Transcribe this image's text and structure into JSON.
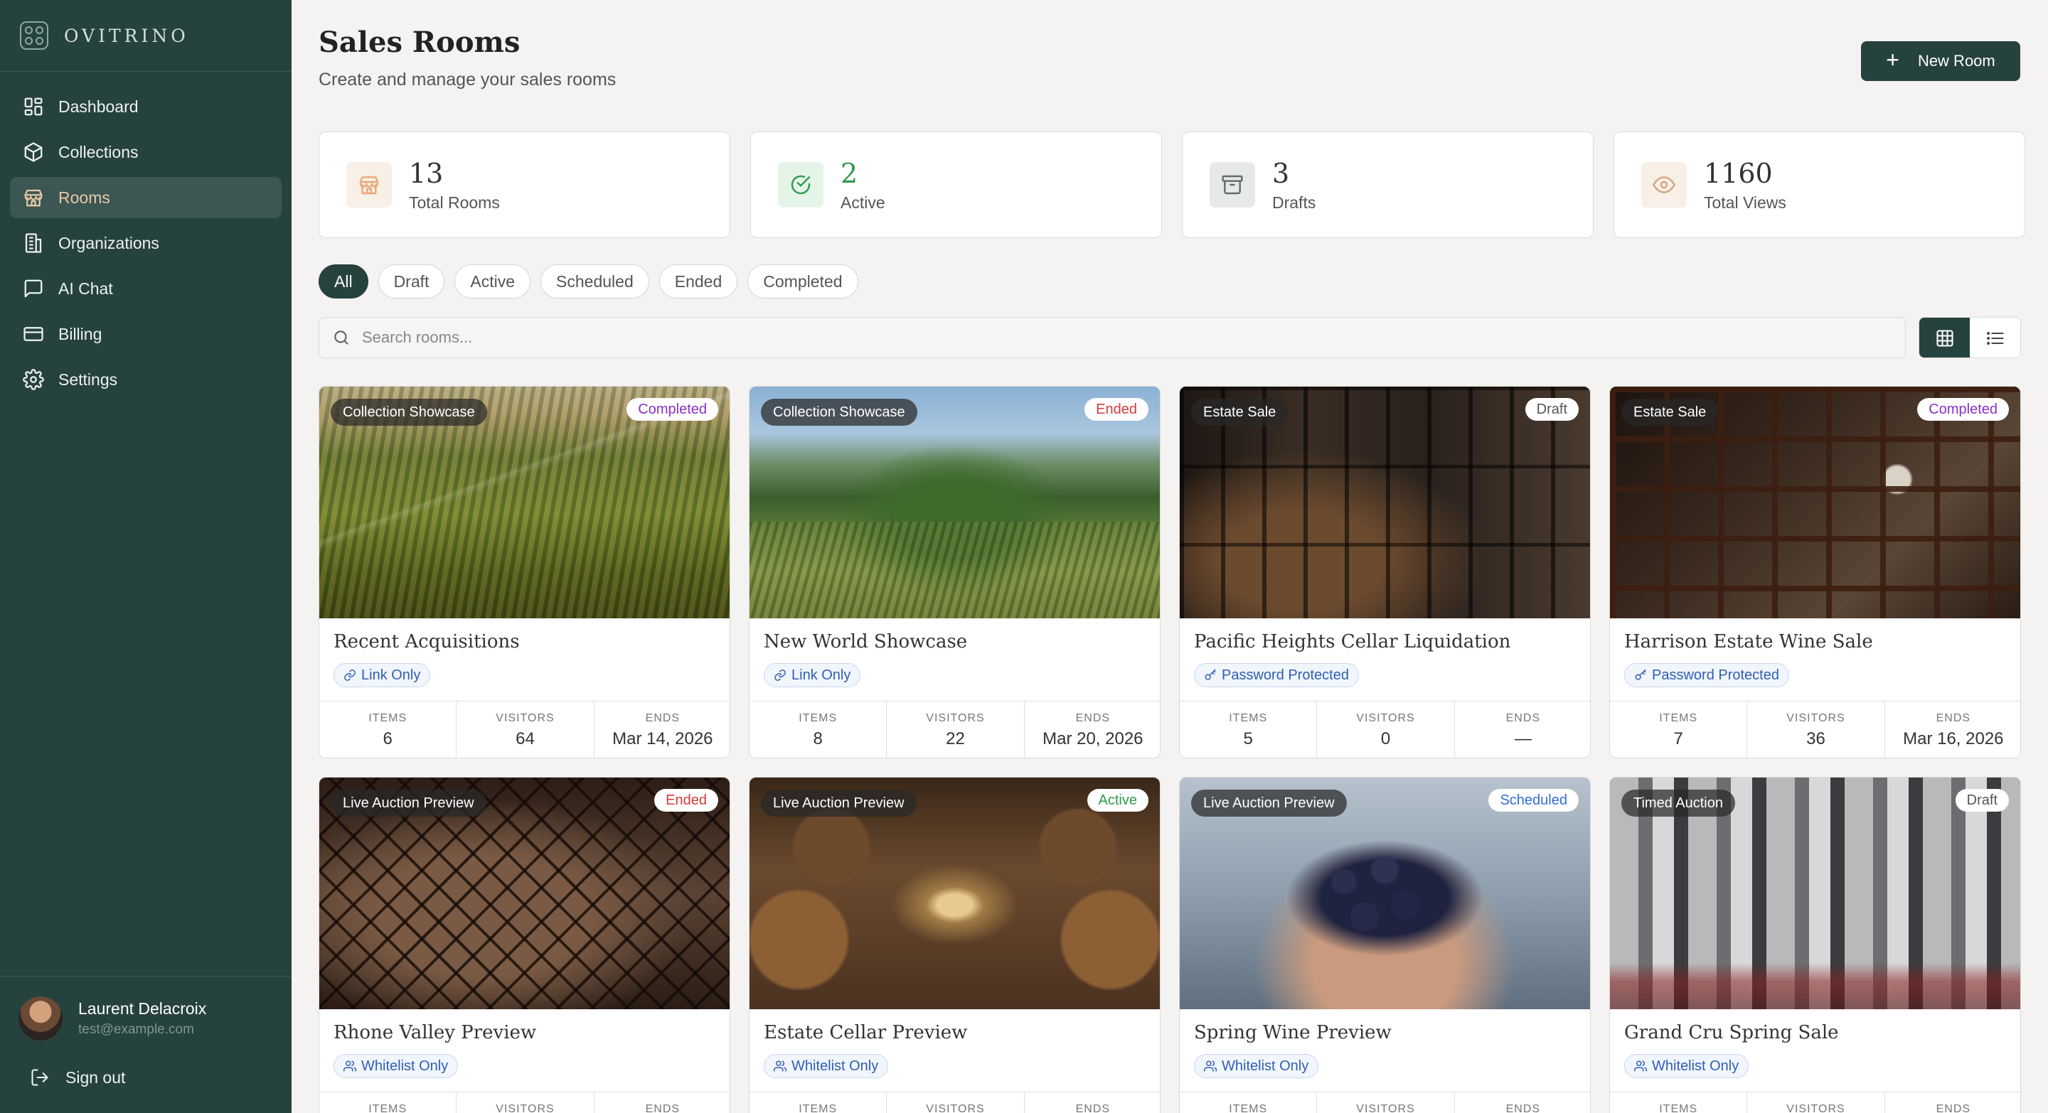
{
  "brand": {
    "name": "OVITRINO"
  },
  "nav": [
    {
      "label": "Dashboard",
      "icon": "dashboard-icon",
      "active": false
    },
    {
      "label": "Collections",
      "icon": "package-icon",
      "active": false
    },
    {
      "label": "Rooms",
      "icon": "store-icon",
      "active": true
    },
    {
      "label": "Organizations",
      "icon": "building-icon",
      "active": false
    },
    {
      "label": "AI Chat",
      "icon": "chat-icon",
      "active": false
    },
    {
      "label": "Billing",
      "icon": "credit-card-icon",
      "active": false
    },
    {
      "label": "Settings",
      "icon": "gear-icon",
      "active": false
    }
  ],
  "user": {
    "name": "Laurent Delacroix",
    "email": "test@example.com",
    "signout_label": "Sign out"
  },
  "header": {
    "title": "Sales Rooms",
    "subtitle": "Create and manage your sales rooms",
    "new_room_label": "New Room"
  },
  "stats": [
    {
      "value": "13",
      "label": "Total Rooms",
      "icon": "store-icon",
      "color": "#e8a97a",
      "bg": "#f8efe6",
      "value_color": "#333333"
    },
    {
      "value": "2",
      "label": "Active",
      "icon": "check-circle-icon",
      "color": "#2f9a4d",
      "bg": "#e4f4e7",
      "value_color": "#2f9a4d"
    },
    {
      "value": "3",
      "label": "Drafts",
      "icon": "archive-icon",
      "color": "#5e6c6a",
      "bg": "#e6e9e8",
      "value_color": "#333333"
    },
    {
      "value": "1160",
      "label": "Total Views",
      "icon": "eye-icon",
      "color": "#d6a47e",
      "bg": "#f8efe6",
      "value_color": "#333333"
    }
  ],
  "filters": [
    {
      "label": "All",
      "active": true
    },
    {
      "label": "Draft",
      "active": false
    },
    {
      "label": "Active",
      "active": false
    },
    {
      "label": "Scheduled",
      "active": false
    },
    {
      "label": "Ended",
      "active": false
    },
    {
      "label": "Completed",
      "active": false
    }
  ],
  "search": {
    "placeholder": "Search rooms..."
  },
  "stat_labels": {
    "items": "ITEMS",
    "visitors": "VISITORS",
    "ends": "ENDS"
  },
  "rooms": [
    {
      "title": "Recent Acquisitions",
      "type": "Collection Showcase",
      "status": "Completed",
      "status_color": "#8a2fc9",
      "access": "Link Only",
      "access_icon": "link-icon",
      "items": "6",
      "visitors": "64",
      "ends": "Mar 14, 2026",
      "image": "img-vineyard1"
    },
    {
      "title": "New World Showcase",
      "type": "Collection Showcase",
      "status": "Ended",
      "status_color": "#d23a3a",
      "access": "Link Only",
      "access_icon": "link-icon",
      "items": "8",
      "visitors": "22",
      "ends": "Mar 20, 2026",
      "image": "img-vineyard2"
    },
    {
      "title": "Pacific Heights Cellar Liquidation",
      "type": "Estate Sale",
      "status": "Draft",
      "status_color": "#555555",
      "access": "Password Protected",
      "access_icon": "key-icon",
      "items": "5",
      "visitors": "0",
      "ends": "—",
      "image": "img-cellar1"
    },
    {
      "title": "Harrison Estate Wine Sale",
      "type": "Estate Sale",
      "status": "Completed",
      "status_color": "#8a2fc9",
      "access": "Password Protected",
      "access_icon": "key-icon",
      "items": "7",
      "visitors": "36",
      "ends": "Mar 16, 2026",
      "image": "img-cellar2"
    },
    {
      "title": "Rhone Valley Preview",
      "type": "Live Auction Preview",
      "status": "Ended",
      "status_color": "#d23a3a",
      "access": "Whitelist Only",
      "access_icon": "users-icon",
      "items": "",
      "visitors": "",
      "ends": "",
      "image": "img-rack"
    },
    {
      "title": "Estate Cellar Preview",
      "type": "Live Auction Preview",
      "status": "Active",
      "status_color": "#2f9a4d",
      "access": "Whitelist Only",
      "access_icon": "users-icon",
      "items": "",
      "visitors": "",
      "ends": "",
      "image": "img-barrels"
    },
    {
      "title": "Spring Wine Preview",
      "type": "Live Auction Preview",
      "status": "Scheduled",
      "status_color": "#2f6fd0",
      "access": "Whitelist Only",
      "access_icon": "users-icon",
      "items": "",
      "visitors": "",
      "ends": "",
      "image": "img-grapes"
    },
    {
      "title": "Grand Cru Spring Sale",
      "type": "Timed Auction",
      "status": "Draft",
      "status_color": "#555555",
      "access": "Whitelist Only",
      "access_icon": "users-icon",
      "items": "",
      "visitors": "",
      "ends": "",
      "image": "img-tanks"
    }
  ]
}
